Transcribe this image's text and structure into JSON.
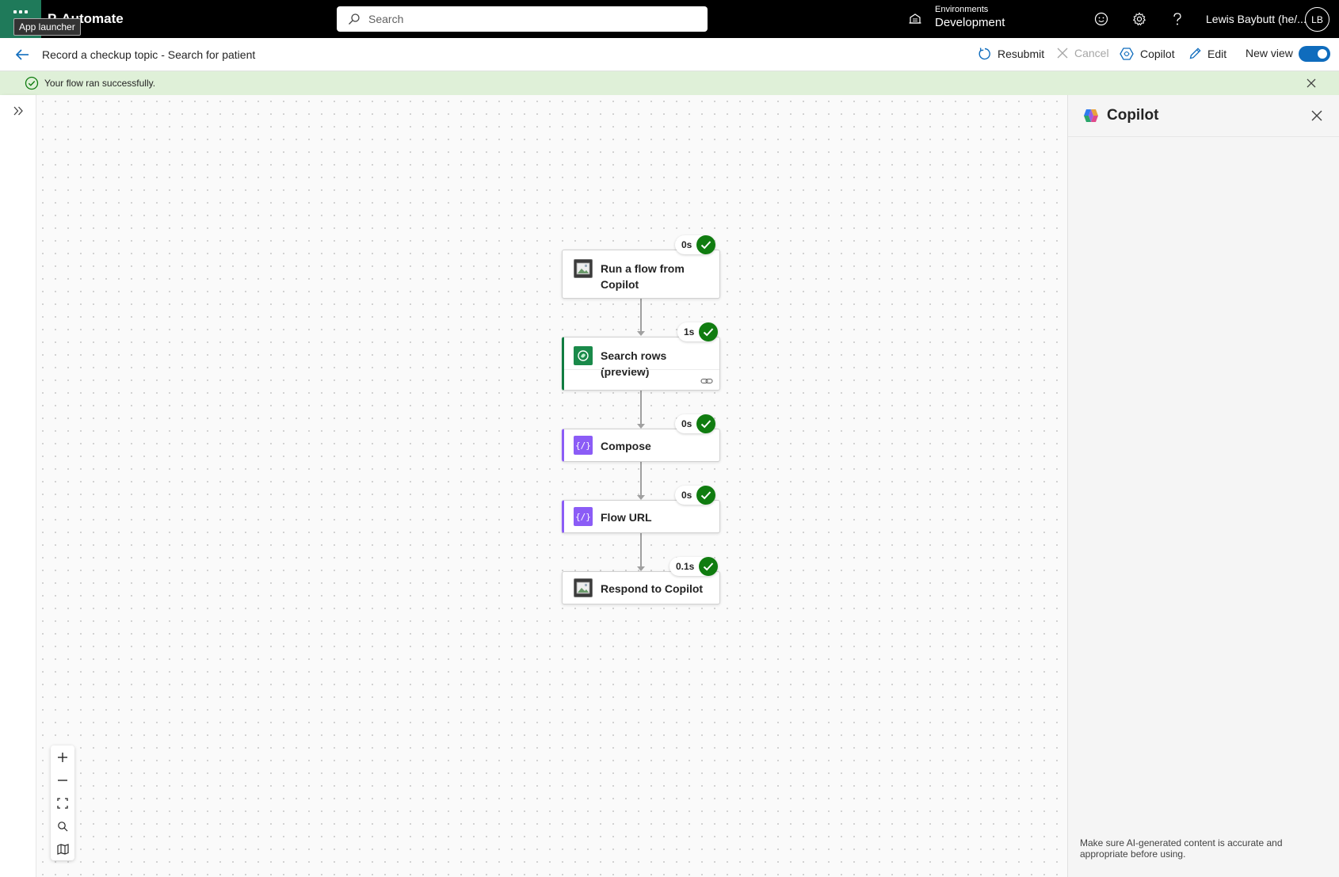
{
  "app": {
    "brand_partial": "P",
    "brand_name": "Automate",
    "launcher_tooltip": "App launcher"
  },
  "search": {
    "placeholder": "Search"
  },
  "environment": {
    "label": "Environments",
    "value": "Development"
  },
  "user": {
    "name": "Lewis Baybutt (he/...",
    "initials": "LB"
  },
  "command_bar": {
    "title": "Record a checkup topic - Search for patient",
    "resubmit": "Resubmit",
    "cancel": "Cancel",
    "copilot": "Copilot",
    "edit": "Edit",
    "new_view": "New view",
    "new_view_on": true
  },
  "banner": {
    "message": "Your flow ran successfully."
  },
  "flow": {
    "steps": [
      {
        "label": "Run a flow from Copilot",
        "duration": "0s",
        "status": "succeeded",
        "icon": "image-placeholder-icon"
      },
      {
        "label": "Search rows (preview)",
        "duration": "1s",
        "status": "succeeded",
        "icon": "dataverse-icon"
      },
      {
        "label": "Compose",
        "duration": "0s",
        "status": "succeeded",
        "icon": "compose-icon"
      },
      {
        "label": "Flow URL",
        "duration": "0s",
        "status": "succeeded",
        "icon": "compose-icon"
      },
      {
        "label": "Respond to Copilot",
        "duration": "0.1s",
        "status": "succeeded",
        "icon": "image-placeholder-icon"
      }
    ]
  },
  "copilot_panel": {
    "title": "Copilot",
    "disclaimer": "Make sure AI-generated content is accurate and appropriate before using."
  },
  "colors": {
    "topbar": "#000000",
    "waffle": "#1f7a5a",
    "accent": "#0f6cbd",
    "success": "#107c10",
    "banner": "#dff0d8",
    "dataverse": "#107c41",
    "compose": "#8b5cf6"
  }
}
